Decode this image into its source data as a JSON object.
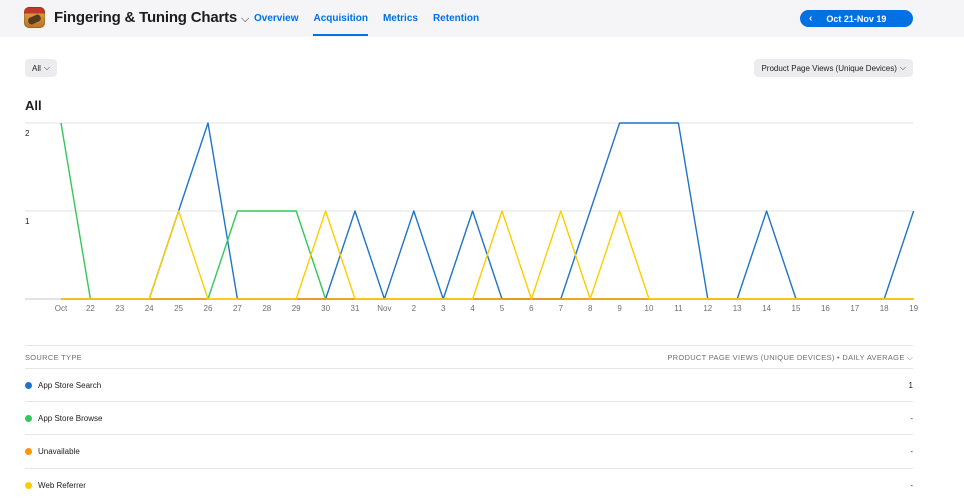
{
  "app": {
    "name": "Fingering & Tuning Charts",
    "dropdown_glyph": "⌵"
  },
  "tabs": [
    {
      "label": "Overview",
      "active": false
    },
    {
      "label": "Acquisition",
      "active": true
    },
    {
      "label": "Metrics",
      "active": false
    },
    {
      "label": "Retention",
      "active": false
    }
  ],
  "date_range": {
    "prev_glyph": "‹",
    "label": "Oct 21-Nov 19"
  },
  "filter": {
    "label": "All",
    "glyph": "⌵"
  },
  "metric_select": {
    "label": "Product Page Views (Unique Devices)",
    "glyph": "⌵"
  },
  "section_title": "All",
  "table": {
    "header_left": "SOURCE TYPE",
    "header_right": "PRODUCT PAGE VIEWS (UNIQUE DEVICES) • DAILY AVERAGE ⌵",
    "rows": [
      {
        "name": "App Store Search",
        "value": "1",
        "color": "#1f74c9"
      },
      {
        "name": "App Store Browse",
        "value": "-",
        "color": "#34c759"
      },
      {
        "name": "Unavailable",
        "value": "-",
        "color": "#ff9500"
      },
      {
        "name": "Web Referrer",
        "value": "-",
        "color": "#ffcc00"
      }
    ]
  },
  "chart_data": {
    "type": "line",
    "x": [
      "Oct",
      "22",
      "23",
      "24",
      "25",
      "26",
      "27",
      "28",
      "29",
      "30",
      "31",
      "Nov",
      "2",
      "3",
      "4",
      "5",
      "6",
      "7",
      "8",
      "9",
      "10",
      "11",
      "12",
      "13",
      "14",
      "15",
      "16",
      "17",
      "18",
      "19"
    ],
    "ylim": [
      0,
      2
    ],
    "yticks": [
      "2",
      "1"
    ],
    "grid": true,
    "series": [
      {
        "name": "App Store Search",
        "color": "#1f74c9",
        "values": [
          0,
          0,
          0,
          0,
          1,
          2,
          0,
          0,
          0,
          0,
          1,
          0,
          1,
          0,
          1,
          0,
          0,
          0,
          1,
          2,
          2,
          2,
          0,
          0,
          1,
          0,
          0,
          0,
          0,
          1
        ]
      },
      {
        "name": "App Store Browse",
        "color": "#34c759",
        "values": [
          2,
          0,
          0,
          0,
          0,
          0,
          1,
          1,
          1,
          0,
          0,
          0,
          0,
          0,
          0,
          0,
          0,
          0,
          0,
          0,
          0,
          0,
          0,
          0,
          0,
          0,
          0,
          0,
          0,
          0
        ]
      },
      {
        "name": "Unavailable",
        "color": "#ff9500",
        "values": [
          0,
          0,
          0,
          0,
          0,
          0,
          0,
          0,
          0,
          0,
          0,
          0,
          0,
          0,
          0,
          0,
          0,
          0,
          0,
          0,
          0,
          0,
          0,
          0,
          0,
          0,
          0,
          0,
          0,
          0
        ]
      },
      {
        "name": "Web Referrer",
        "color": "#ffcc00",
        "values": [
          0,
          0,
          0,
          0,
          1,
          0,
          0,
          0,
          0,
          1,
          0,
          0,
          0,
          0,
          0,
          1,
          0,
          1,
          0,
          1,
          0,
          0,
          0,
          0,
          0,
          0,
          0,
          0,
          0,
          0
        ]
      }
    ]
  }
}
